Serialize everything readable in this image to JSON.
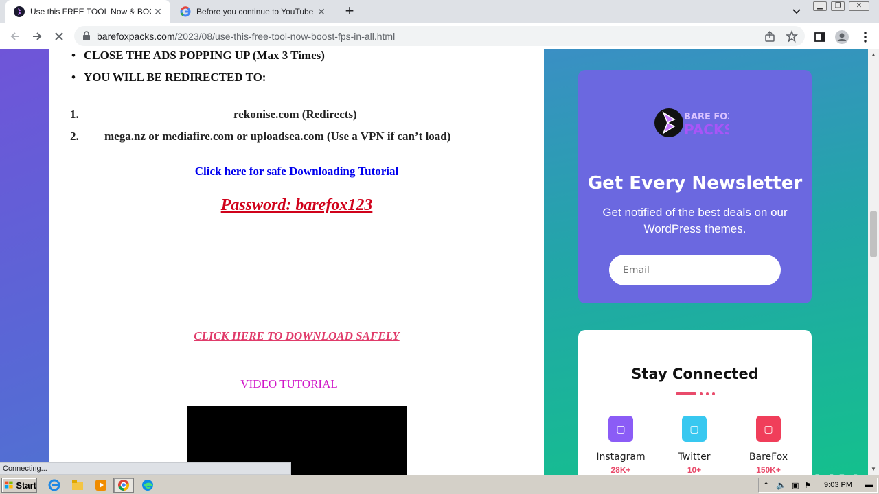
{
  "browser": {
    "tabs": [
      {
        "title": "Use this FREE TOOL Now & BOOST F",
        "active": true
      },
      {
        "title": "Before you continue to YouTube",
        "active": false
      }
    ],
    "url_host": "barefoxpacks.com",
    "url_path": "/2023/08/use-this-free-tool-now-boost-fps-in-all.html",
    "status": "Connecting..."
  },
  "article": {
    "bullets": [
      "CLOSE THE ADS POPPING UP (Max 3 Times)",
      "YOU WILL BE REDIRECTED TO:"
    ],
    "ordered": [
      {
        "num": "1.",
        "text": "rekonise.com (Redirects)"
      },
      {
        "num": "2.",
        "text": "mega.nz or mediafire.com or uploadsea.com (Use a VPN if can’t load)"
      }
    ],
    "tutorial_link": "Click here for safe Downloading Tutorial",
    "password": "Password: barefox123",
    "download_link": "CLICK HERE TO DOWNLOAD SAFELY",
    "video_label": "VIDEO TUTORIAL"
  },
  "sidebar": {
    "logo_top": "BARE FOX",
    "logo_bottom": "PACKS",
    "newsletter_title": "Get Every Newsletter",
    "newsletter_desc": "Get notified of the best deals on our WordPress themes.",
    "email_placeholder": "Email",
    "stay_connected": "Stay Connected",
    "socials": [
      {
        "name": "Instagram",
        "count": "28K+",
        "color": "#8b5cf6"
      },
      {
        "name": "Twitter",
        "count": "10+",
        "color": "#38c8f0"
      },
      {
        "name": "BareFox",
        "count": "150K+",
        "color": "#f03e5a"
      }
    ]
  },
  "watermark": "ANY RUN",
  "taskbar": {
    "start_label": "Start",
    "clock": "9:03 PM"
  }
}
